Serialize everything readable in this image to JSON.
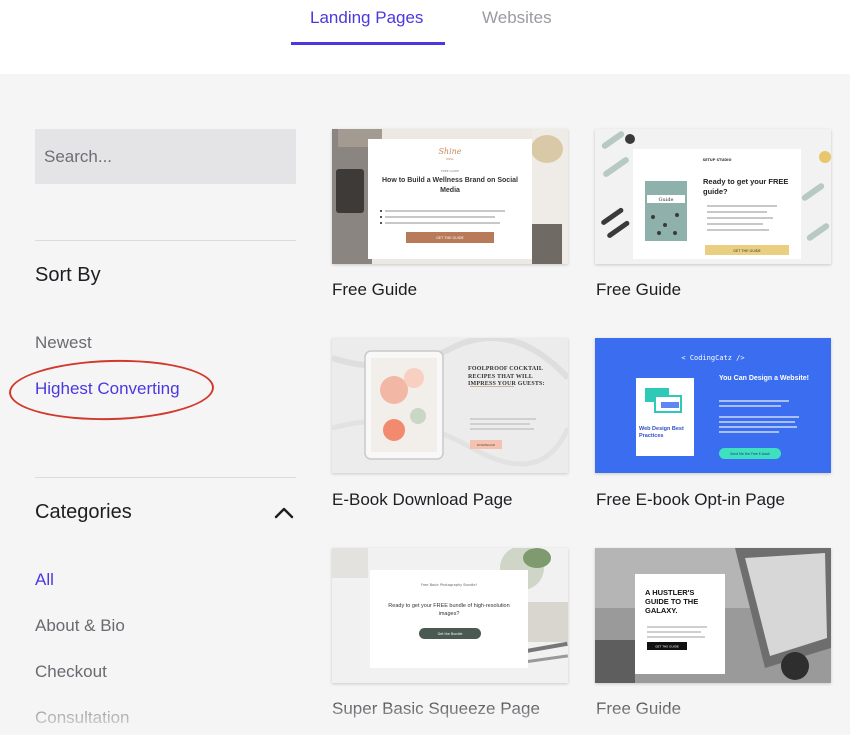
{
  "tabs": [
    {
      "label": "Landing Pages",
      "active": true
    },
    {
      "label": "Websites",
      "active": false
    }
  ],
  "search": {
    "placeholder": "Search..."
  },
  "sort": {
    "heading": "Sort By",
    "options": [
      {
        "label": "Newest",
        "active": false
      },
      {
        "label": "Highest Converting",
        "active": true
      }
    ]
  },
  "categories": {
    "heading": "Categories",
    "items": [
      {
        "label": "All",
        "active": true
      },
      {
        "label": "About & Bio",
        "active": false
      },
      {
        "label": "Checkout",
        "active": false
      },
      {
        "label": "Consultation",
        "active": false
      }
    ]
  },
  "templates": [
    {
      "title": "Free Guide",
      "preview": {
        "logo": "Shine",
        "logo_sub": "WELL",
        "kicker": "FREE GUIDE",
        "headline": "How to Build a Wellness Brand on Social Media",
        "button": "GET THE GUIDE"
      }
    },
    {
      "title": "Free Guide",
      "preview": {
        "brand": "SETUP STUDIO",
        "book": "Guide",
        "headline": "Ready to get your FREE guide?",
        "button": "GET THE GUIDE"
      }
    },
    {
      "title": "E-Book Download Page",
      "preview": {
        "headline": "FOOLPROOF COCKTAIL RECIPES THAT WILL IMPRESS YOUR GUESTS:",
        "button": "DOWNLOAD"
      }
    },
    {
      "title": "Free E-book Opt-in Page",
      "preview": {
        "brand": "< CodingCatz />",
        "headline": "You Can Design a Website!",
        "book": "Web Design Best Practices",
        "button": "Send Me the Free E-book"
      }
    },
    {
      "title": "Super Basic Squeeze Page",
      "preview": {
        "kicker": "Free Basic Photography Bundle!",
        "headline": "Ready to get your FREE bundle of high-resolution images?",
        "button": "Get the Bundle"
      }
    },
    {
      "title": "Free Guide",
      "preview": {
        "headline": "A HUSTLER'S GUIDE TO THE GALAXY.",
        "button": "GET THE GUIDE"
      }
    }
  ],
  "colors": {
    "accent": "#4a38e0",
    "annotation": "#d2382c",
    "coding_blue": "#3a6df0"
  },
  "icons": {
    "collapse": "chevron-up-icon"
  }
}
